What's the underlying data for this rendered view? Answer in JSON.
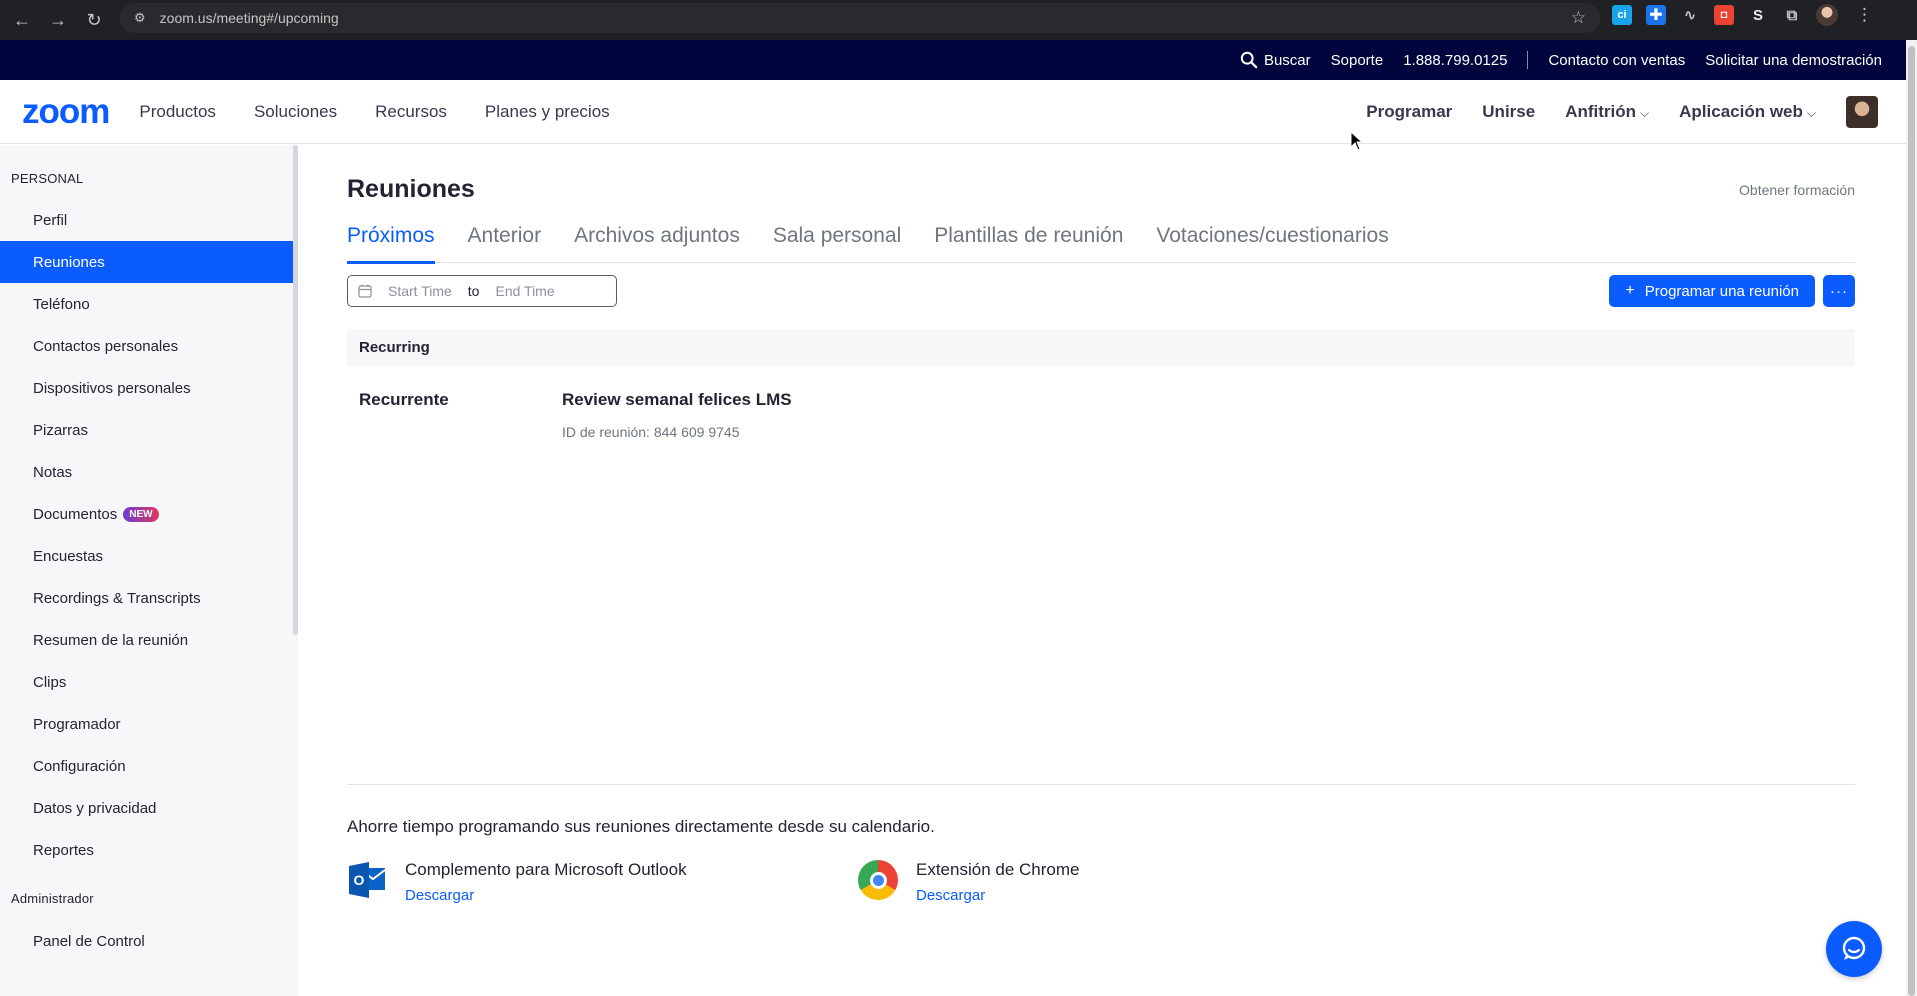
{
  "browser": {
    "url": "zoom.us/meeting#/upcoming",
    "extensions": [
      "ci-extension",
      "plus-extension",
      "link-extension",
      "red-extension",
      "s-extension",
      "puzzle-extension"
    ],
    "ext_labels": [
      "ci",
      "✚",
      "",
      "",
      "S",
      ""
    ]
  },
  "util_bar": {
    "search": "Buscar",
    "support": "Soporte",
    "phone": "1.888.799.0125",
    "contact_sales": "Contacto con ventas",
    "request_demo": "Solicitar una demostración"
  },
  "header": {
    "logo": "zoom",
    "nav": [
      "Productos",
      "Soluciones",
      "Recursos",
      "Planes y precios"
    ],
    "schedule": "Programar",
    "join": "Unirse",
    "host": "Anfitrión",
    "web_app": "Aplicación web"
  },
  "sidebar": {
    "personal_label": "PERSONAL",
    "items": [
      {
        "label": "Perfil"
      },
      {
        "label": "Reuniones"
      },
      {
        "label": "Teléfono"
      },
      {
        "label": "Contactos personales"
      },
      {
        "label": "Dispositivos personales"
      },
      {
        "label": "Pizarras"
      },
      {
        "label": "Notas"
      },
      {
        "label": "Documentos"
      },
      {
        "label": "Encuestas"
      },
      {
        "label": "Recordings & Transcripts"
      },
      {
        "label": "Resumen de la reunión"
      },
      {
        "label": "Clips"
      },
      {
        "label": "Programador"
      },
      {
        "label": "Configuración"
      },
      {
        "label": "Datos y privacidad"
      },
      {
        "label": "Reportes"
      }
    ],
    "new_badge": "NEW",
    "admin_label": "Administrador",
    "admin_items": [
      {
        "label": "Panel de Control"
      }
    ]
  },
  "main": {
    "title": "Reuniones",
    "training_link": "Obtener formación",
    "tabs": [
      {
        "label": "Próximos"
      },
      {
        "label": "Anterior"
      },
      {
        "label": "Archivos adjuntos"
      },
      {
        "label": "Sala personal"
      },
      {
        "label": "Plantillas de reunión"
      },
      {
        "label": "Votaciones/cuestionarios"
      }
    ],
    "date_start_placeholder": "Start Time",
    "date_to": "to",
    "date_end_placeholder": "End Time",
    "schedule_button": "Programar una reunión",
    "more_button": "···",
    "group_header": "Recurring",
    "meeting": {
      "type": "Recurrente",
      "topic": "Review semanal felices LMS",
      "meeting_id": "ID de reunión: 844 609 9745"
    },
    "promo_text": "Ahorre tiempo programando sus reuniones directamente desde su calendario.",
    "outlook": {
      "name": "Complemento para Microsoft Outlook",
      "download": "Descargar"
    },
    "chrome": {
      "name": "Extensión de Chrome",
      "download": "Descargar"
    }
  },
  "colors": {
    "accent": "#0b5cff",
    "util_bar_bg": "#00053d",
    "sidebar_bg": "#f7f7fa"
  }
}
